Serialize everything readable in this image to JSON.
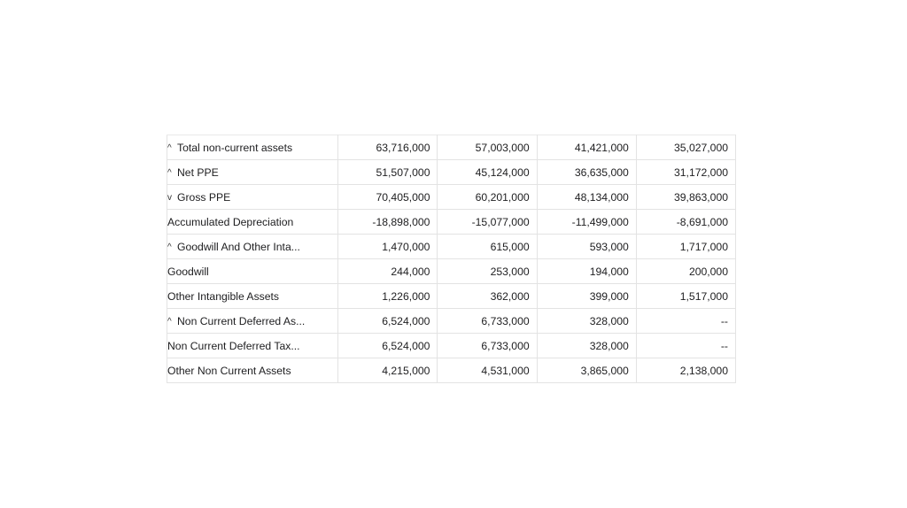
{
  "rows": [
    {
      "label": "Total non-current assets",
      "chevron": "^",
      "values": [
        "63,716,000",
        "57,003,000",
        "41,421,000",
        "35,027,000"
      ]
    },
    {
      "label": "Net PPE",
      "chevron": "^",
      "values": [
        "51,507,000",
        "45,124,000",
        "36,635,000",
        "31,172,000"
      ]
    },
    {
      "label": "Gross PPE",
      "chevron": "v",
      "values": [
        "70,405,000",
        "60,201,000",
        "48,134,000",
        "39,863,000"
      ]
    },
    {
      "label": "Accumulated Depreciation",
      "chevron": "",
      "values": [
        "-18,898,000",
        "-15,077,000",
        "-11,499,000",
        "-8,691,000"
      ]
    },
    {
      "label": "Goodwill And Other Inta...",
      "chevron": "^",
      "values": [
        "1,470,000",
        "615,000",
        "593,000",
        "1,717,000"
      ]
    },
    {
      "label": "Goodwill",
      "chevron": "",
      "values": [
        "244,000",
        "253,000",
        "194,000",
        "200,000"
      ]
    },
    {
      "label": "Other Intangible Assets",
      "chevron": "",
      "values": [
        "1,226,000",
        "362,000",
        "399,000",
        "1,517,000"
      ]
    },
    {
      "label": "Non Current Deferred As...",
      "chevron": "^",
      "values": [
        "6,524,000",
        "6,733,000",
        "328,000",
        "--"
      ]
    },
    {
      "label": "Non Current Deferred Tax...",
      "chevron": "",
      "values": [
        "6,524,000",
        "6,733,000",
        "328,000",
        "--"
      ]
    },
    {
      "label": "Other Non Current Assets",
      "chevron": "",
      "values": [
        "4,215,000",
        "4,531,000",
        "3,865,000",
        "2,138,000"
      ]
    }
  ]
}
